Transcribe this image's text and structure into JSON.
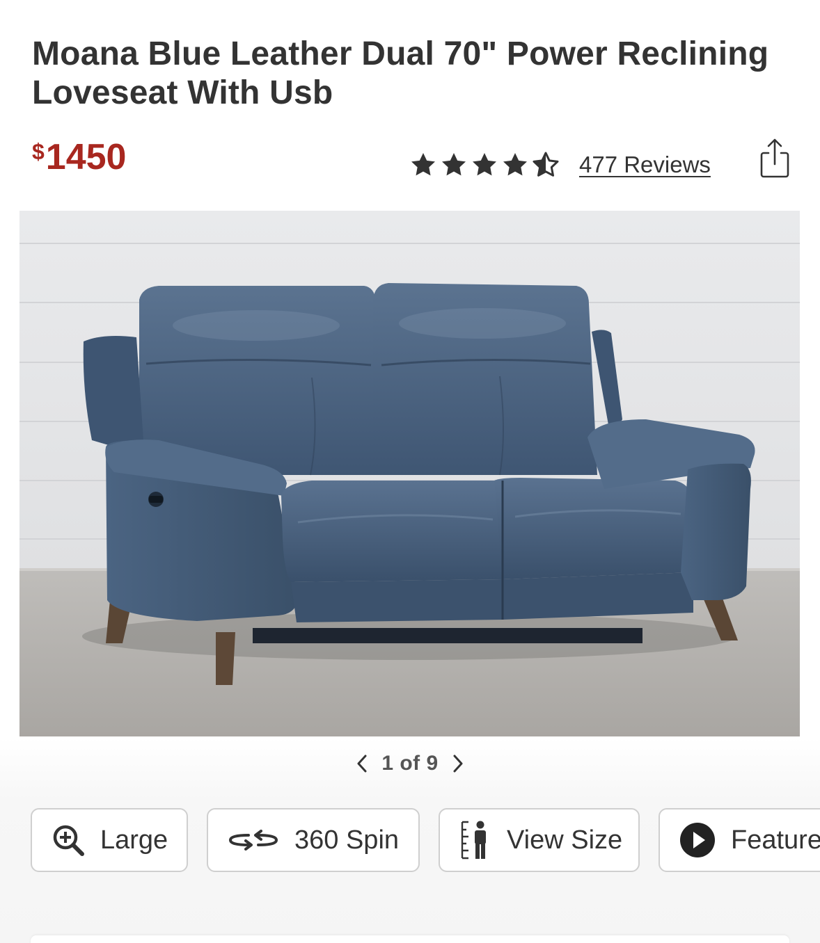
{
  "product": {
    "title": "Moana Blue Leather Dual 70\" Power Reclining Loveseat With Usb",
    "price_currency": "$",
    "price_amount": "1450",
    "price_color": "#a8271f",
    "rating": 4.5,
    "rating_max": 5,
    "reviews_label": "477 Reviews",
    "share_icon": "share-icon"
  },
  "gallery": {
    "image_alt": "Blue leather power reclining loveseat",
    "current_index": "1",
    "of_label": "of",
    "total": "9",
    "counter": "1 of 9",
    "prev_icon": "chevron-left-icon",
    "next_icon": "chevron-right-icon"
  },
  "toolbar": {
    "buttons": [
      {
        "label": "Large",
        "icon": "zoom-in-icon"
      },
      {
        "label": "360 Spin",
        "icon": "spin-icon"
      },
      {
        "label": "View Size",
        "icon": "ruler-person-icon"
      },
      {
        "label": "Features",
        "icon": "play-icon"
      }
    ]
  }
}
